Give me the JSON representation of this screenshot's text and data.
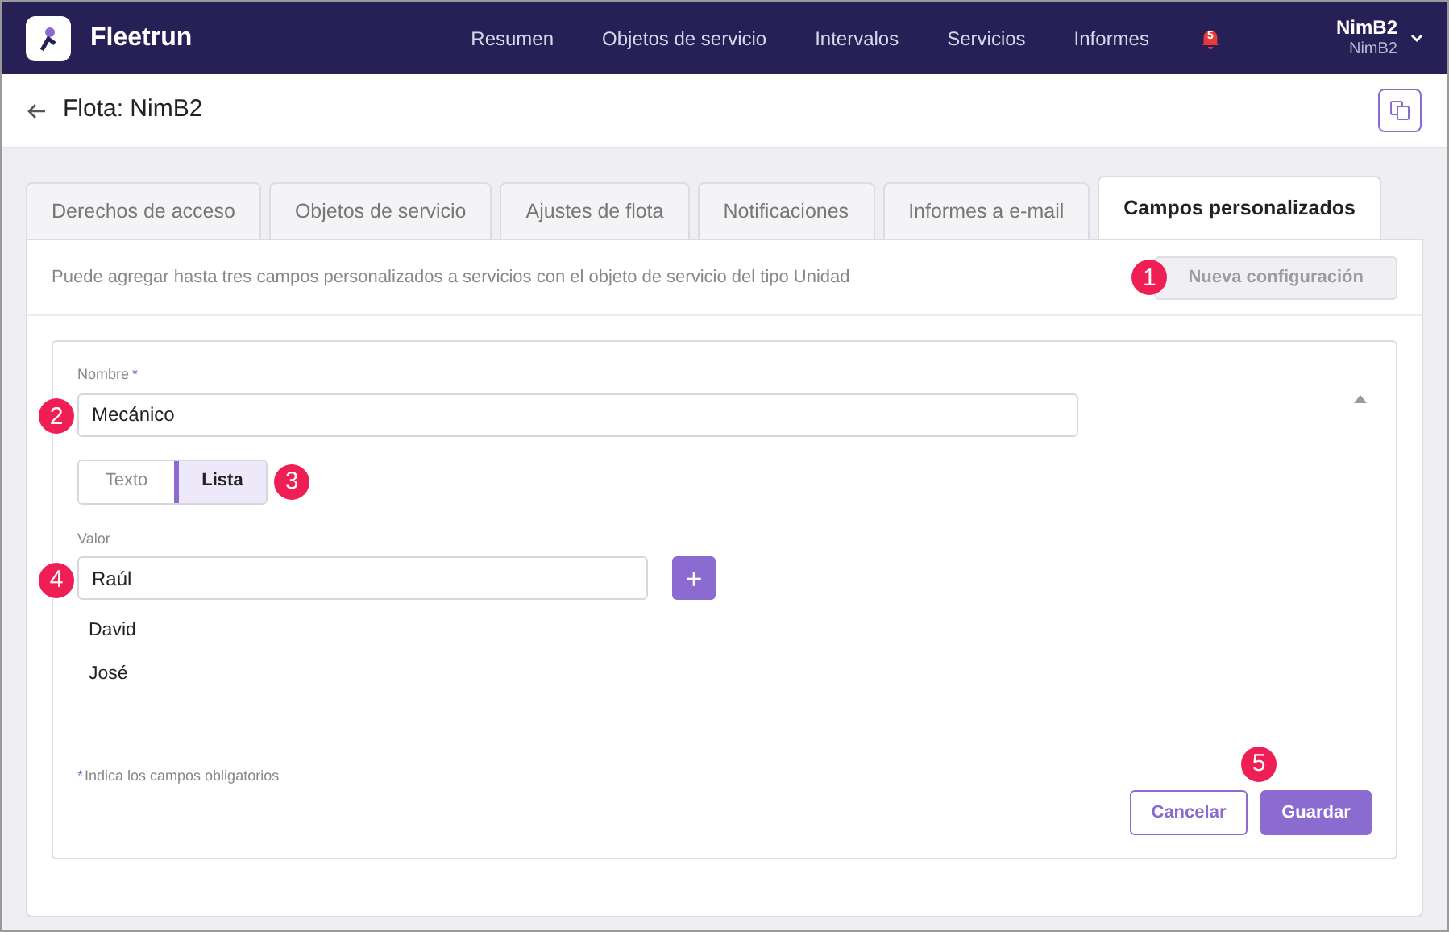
{
  "app": {
    "name": "Fleetrun"
  },
  "nav": {
    "items": [
      {
        "label": "Resumen"
      },
      {
        "label": "Objetos de servicio"
      },
      {
        "label": "Intervalos"
      },
      {
        "label": "Servicios"
      },
      {
        "label": "Informes"
      }
    ],
    "notifications": "5"
  },
  "user": {
    "name": "NimB2",
    "subtitle": "NimB2"
  },
  "page": {
    "title": "Flota: NimB2"
  },
  "tabs": [
    {
      "label": "Derechos de acceso",
      "selected": false
    },
    {
      "label": "Objetos de servicio",
      "selected": false
    },
    {
      "label": "Ajustes de flota",
      "selected": false
    },
    {
      "label": "Notificaciones",
      "selected": false
    },
    {
      "label": "Informes a e-mail",
      "selected": false
    },
    {
      "label": "Campos personalizados",
      "selected": true
    }
  ],
  "info": {
    "text": "Puede agregar hasta tres campos personalizados a servicios con el objeto de servicio del tipo Unidad",
    "button": "Nueva configuración",
    "button_disabled": true,
    "callout": "1"
  },
  "form": {
    "name_label": "Nombre",
    "required_mark": "*",
    "name_value": "Mecánico",
    "name_callout": "2",
    "type_options": [
      {
        "label": "Texto",
        "selected": false
      },
      {
        "label": "Lista",
        "selected": true
      }
    ],
    "type_callout": "3",
    "value_label": "Valor",
    "value": "Raúl",
    "value_callout": "4",
    "add_button": "+",
    "list_items": [
      "David",
      "José"
    ],
    "required_note": "Indica los campos obligatorios",
    "cancel": "Cancelar",
    "save": "Guardar",
    "save_callout": "5"
  }
}
